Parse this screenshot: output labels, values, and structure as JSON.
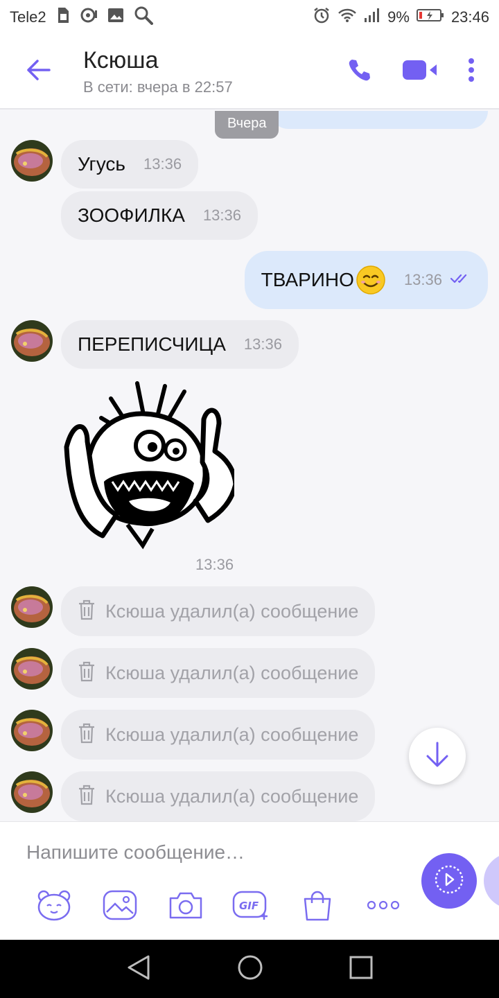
{
  "status_bar": {
    "carrier": "Tele2",
    "battery": "9%",
    "time": "23:46"
  },
  "header": {
    "contact_name": "Ксюша",
    "contact_status": "В сети: вчера в 22:57"
  },
  "chat": {
    "date_chip": "Вчера",
    "messages": [
      {
        "direction": "in",
        "text": "Угусь",
        "time": "13:36"
      },
      {
        "direction": "in",
        "text": "ЗООФИЛКА",
        "time": "13:36"
      },
      {
        "direction": "out",
        "text": "ТВАРИНО",
        "emoji": "smiling-face",
        "time": "13:36",
        "status": "read"
      },
      {
        "direction": "in",
        "text": "ПЕРЕПИСЧИЦА",
        "time": "13:36"
      },
      {
        "direction": "in",
        "type": "sticker",
        "time": "13:36"
      },
      {
        "direction": "in",
        "type": "deleted",
        "text": "Ксюша удалил(а) сообщение"
      },
      {
        "direction": "in",
        "type": "deleted",
        "text": "Ксюша удалил(а) сообщение"
      },
      {
        "direction": "in",
        "type": "deleted",
        "text": "Ксюша удалил(а) сообщение"
      },
      {
        "direction": "in",
        "type": "deleted",
        "text": "Ксюша удалил(а) сообщение"
      }
    ]
  },
  "composer": {
    "placeholder": "Напишите сообщение…",
    "tools": [
      "sticker-icon",
      "gallery-icon",
      "camera-icon",
      "gif-icon",
      "shopping-bag-icon",
      "more-dots-icon"
    ]
  },
  "colors": {
    "accent": "#7360f2",
    "outgoing_bubble": "#dce9fb",
    "incoming_bubble": "#ebebef"
  }
}
